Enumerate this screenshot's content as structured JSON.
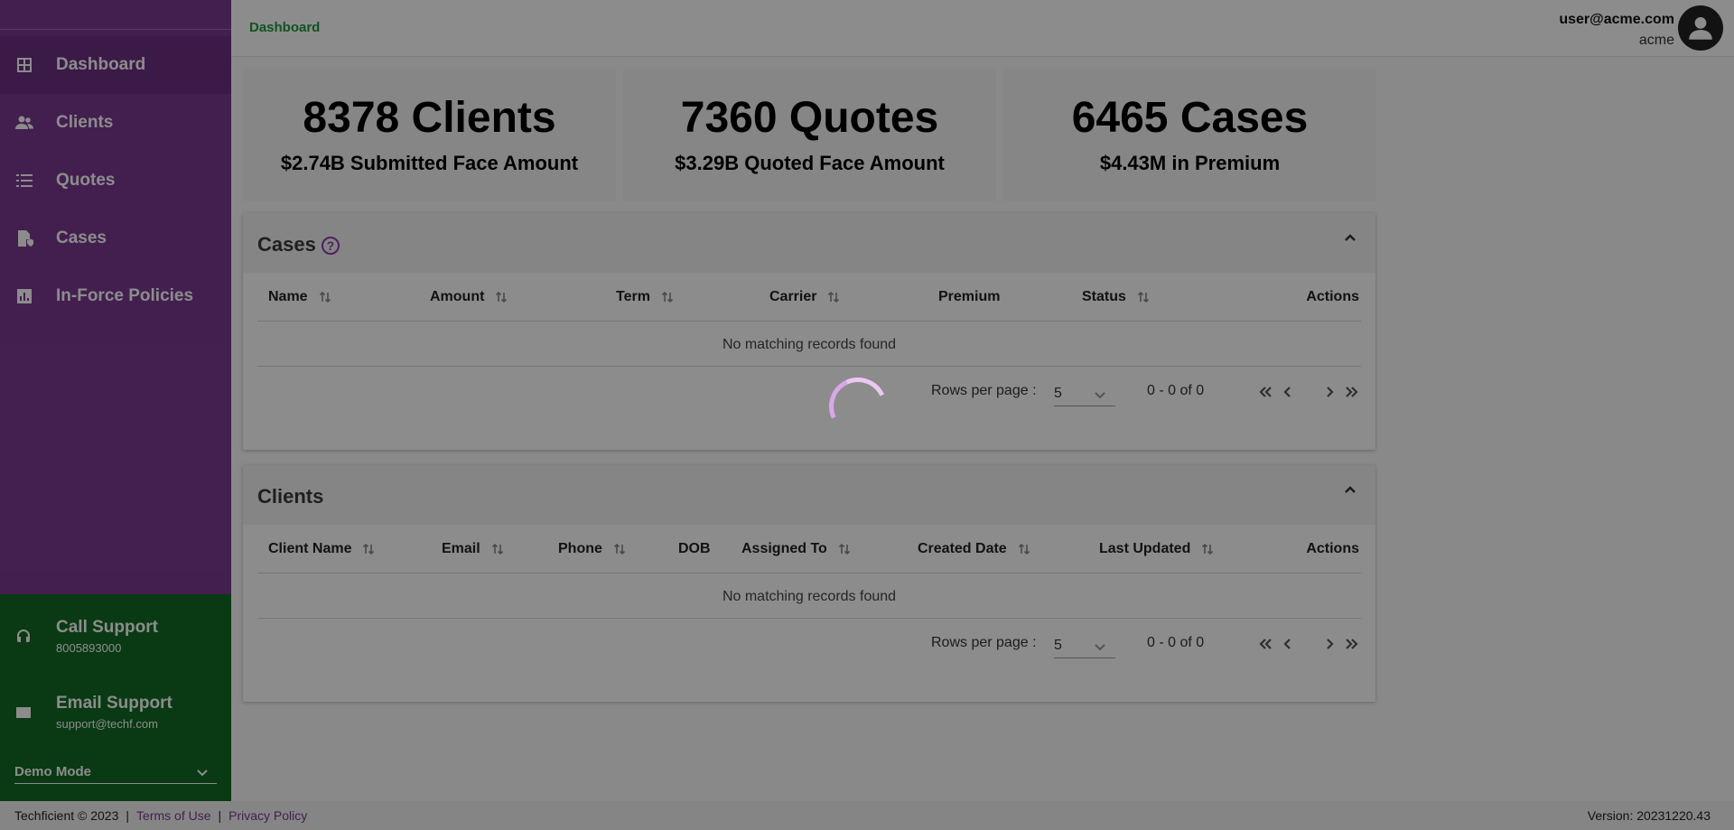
{
  "sidebar": {
    "nav": [
      {
        "label": "Dashboard",
        "icon": "dashboard-icon"
      },
      {
        "label": "Clients",
        "icon": "people-icon"
      },
      {
        "label": "Quotes",
        "icon": "list-icon"
      },
      {
        "label": "Cases",
        "icon": "case-icon"
      },
      {
        "label": "In-Force Policies",
        "icon": "chart-icon"
      }
    ],
    "call_support": {
      "title": "Call Support",
      "value": "8005893000"
    },
    "email_support": {
      "title": "Email Support",
      "value": "support@techf.com"
    },
    "demo_mode": "Demo Mode"
  },
  "header": {
    "breadcrumb": "Dashboard",
    "user_email": "user@acme.com",
    "user_org": "acme"
  },
  "stats": [
    {
      "big": "8378 Clients",
      "small": "$2.74B Submitted Face Amount"
    },
    {
      "big": "7360 Quotes",
      "small": "$3.29B Quoted Face Amount"
    },
    {
      "big": "6465 Cases",
      "small": "$4.43M in Premium"
    }
  ],
  "cases_panel": {
    "title": "Cases",
    "help": "?",
    "columns": [
      "Name",
      "Amount",
      "Term",
      "Carrier",
      "Premium",
      "Status",
      "Actions"
    ],
    "empty": "No matching records found",
    "rows_per_page_label": "Rows per page :",
    "rows_per_page": "5",
    "range": "0 - 0 of 0"
  },
  "clients_panel": {
    "title": "Clients",
    "columns": [
      "Client Name",
      "Email",
      "Phone",
      "DOB",
      "Assigned To",
      "Created Date",
      "Last Updated",
      "Actions"
    ],
    "empty": "No matching records found",
    "rows_per_page_label": "Rows per page :",
    "rows_per_page": "5",
    "range": "0 - 0 of 0"
  },
  "footer": {
    "copyright": "Techficient © 2023",
    "sep": "|",
    "terms": "Terms of Use",
    "privacy": "Privacy Policy",
    "version": "Version: 20231220.43"
  },
  "colors": {
    "sidebar": "#7b3a92",
    "support": "#116b24",
    "accent": "#1e9a3b"
  }
}
